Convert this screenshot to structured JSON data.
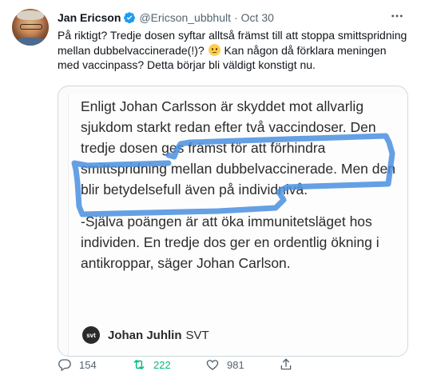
{
  "tweet": {
    "author_name": "Jan Ericson",
    "handle": "@Ericson_ubbhult",
    "separator": "·",
    "date": "Oct 30",
    "text_before_emoji": "På riktigt? Tredje dosen syftar alltså främst till att stoppa smittspridning mellan dubbelvaccinerade(!)? ",
    "text_after_emoji": " Kan någon då förklara meningen med vaccinpass? Detta börjar bli väldigt konstigt nu."
  },
  "media": {
    "paragraph1": "Enligt Johan Carlsson är skyddet mot allvarlig sjukdom starkt redan efter två vaccindoser. Den tredje dosen ges främst för att förhindra smittspridning mellan dubbelvaccinerade. Men den blir betydelsefull även på individnivå.",
    "paragraph2": "-Själva poängen är att öka immunitetsläget hos individen. En tredje dos ger en ordentlig ökning i antikroppar, säger Johan Carlson.",
    "byline_logo": "svt",
    "byline_author": "Johan Juhlin",
    "byline_outlet": "SVT",
    "highlight_color": "#4a8fe0"
  },
  "actions": {
    "replies": "154",
    "retweets": "222",
    "likes": "981"
  },
  "colors": {
    "verified": "#1d9bf0",
    "retweet_active": "#00ba7c",
    "secondary_text": "#536471"
  }
}
